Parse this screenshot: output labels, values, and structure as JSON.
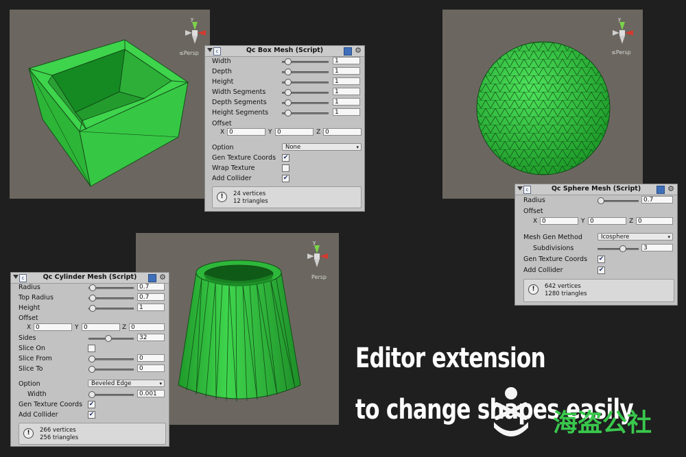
{
  "colors": {
    "viewport_bg": "#6b6760",
    "mesh_green": "#2fbe3a",
    "mesh_dark": "#1f8a2a",
    "inspector_bg": "#c2c2c2",
    "caption": "#ffffff"
  },
  "gizmo": {
    "axis_y": "y",
    "persp": "≤Persp",
    "persp_short": "Persp"
  },
  "box": {
    "title": "Qc Box Mesh (Script)",
    "fields": [
      {
        "label": "Width",
        "value": "1"
      },
      {
        "label": "Depth",
        "value": "1"
      },
      {
        "label": "Height",
        "value": "1"
      },
      {
        "label": "Width Segments",
        "value": "1"
      },
      {
        "label": "Depth Segments",
        "value": "1"
      },
      {
        "label": "Height Segments",
        "value": "1"
      }
    ],
    "offset_label": "Offset",
    "offset": {
      "x_label": "X",
      "x": "0",
      "y_label": "Y",
      "y": "0",
      "z_label": "Z",
      "z": "0"
    },
    "option_label": "Option",
    "option_value": "None",
    "gen_texture": {
      "label": "Gen Texture Coords",
      "checked": true
    },
    "wrap_texture": {
      "label": "Wrap Texture",
      "checked": false
    },
    "add_collider": {
      "label": "Add Collider",
      "checked": true
    },
    "info": {
      "vertices": "24 vertices",
      "triangles": "12 triangles"
    }
  },
  "sphere": {
    "title": "Qc Sphere Mesh (Script)",
    "radius_label": "Radius",
    "radius": "0.7",
    "offset_label": "Offset",
    "offset": {
      "x_label": "X",
      "x": "0",
      "y_label": "Y",
      "y": "0",
      "z_label": "Z",
      "z": "0"
    },
    "method_label": "Mesh Gen Method",
    "method_value": "Icosphere",
    "subdivisions_label": "Subdivisions",
    "subdivisions": "3",
    "gen_texture": {
      "label": "Gen Texture Coords",
      "checked": true
    },
    "add_collider": {
      "label": "Add Collider",
      "checked": true
    },
    "info": {
      "vertices": "642 vertices",
      "triangles": "1280 triangles"
    }
  },
  "cylinder": {
    "title": "Qc Cylinder Mesh (Script)",
    "fields": [
      {
        "label": "Radius",
        "value": "0.7"
      },
      {
        "label": "Top Radius",
        "value": "0.7"
      },
      {
        "label": "Height",
        "value": "1"
      }
    ],
    "offset_label": "Offset",
    "offset": {
      "x_label": "X",
      "x": "0",
      "y_label": "Y",
      "y": "0",
      "z_label": "Z",
      "z": "0"
    },
    "sides_label": "Sides",
    "sides": "32",
    "slice_on": {
      "label": "Slice On",
      "checked": false
    },
    "slice_from_label": "Slice From",
    "slice_from": "0",
    "slice_to_label": "Slice To",
    "slice_to": "0",
    "option_label": "Option",
    "option_value": "Beveled Edge",
    "width_label": "Width",
    "width": "0.001",
    "gen_texture": {
      "label": "Gen Texture Coords",
      "checked": true
    },
    "add_collider": {
      "label": "Add Collider",
      "checked": true
    },
    "info": {
      "vertices": "266 vertices",
      "triangles": "256 triangles"
    }
  },
  "caption": {
    "line1": "Editor extension",
    "line2": "to change shapes easily"
  },
  "watermark": {
    "text": "海盗公社"
  },
  "glyphs": {
    "check": "✔",
    "arrow_down": "▾",
    "gear": "⚙",
    "info": "!",
    "script": "c"
  }
}
